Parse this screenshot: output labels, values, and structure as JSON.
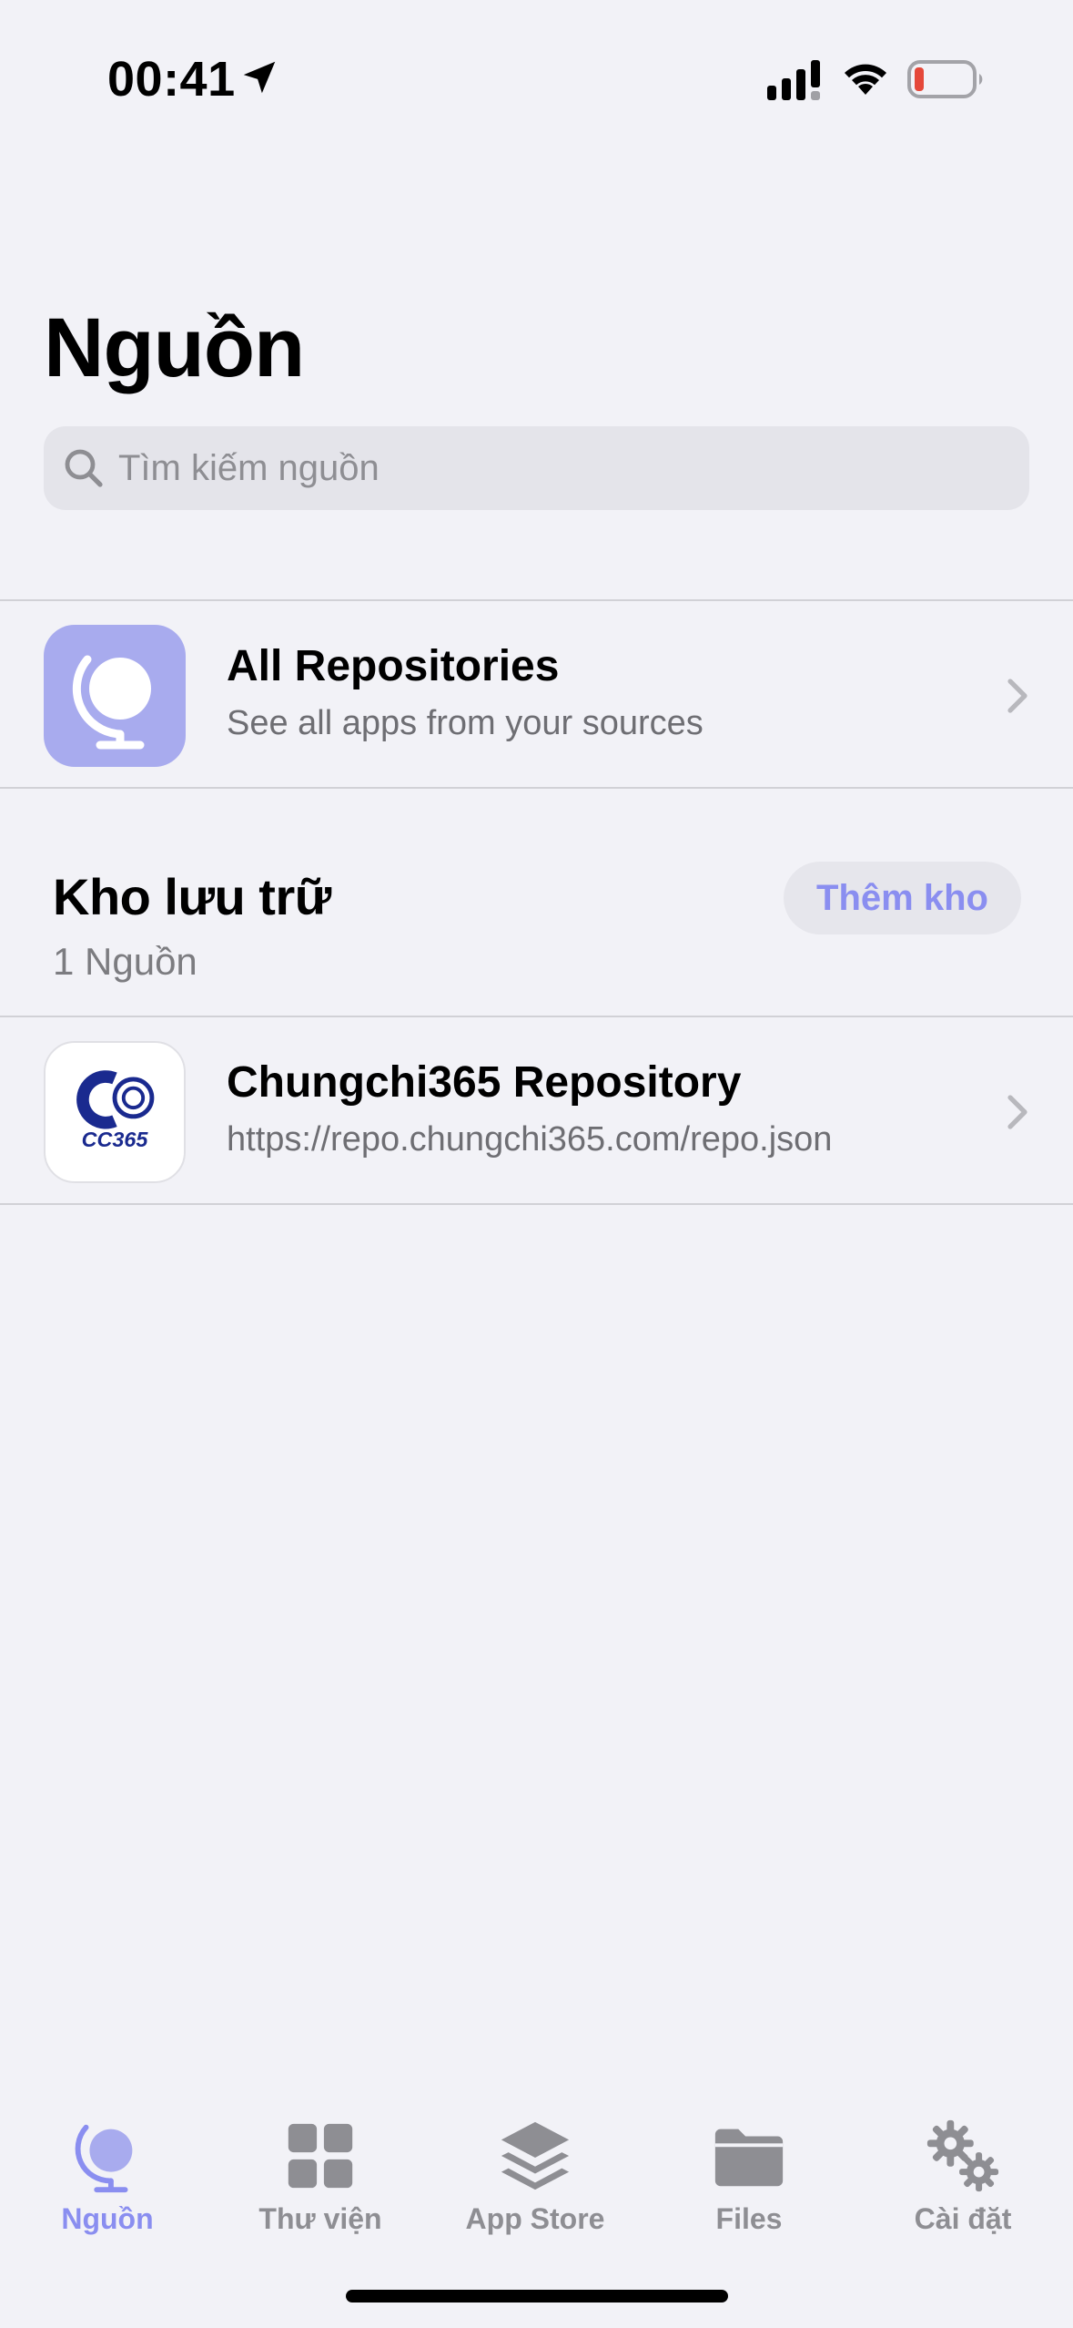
{
  "status_bar": {
    "time": "00:41",
    "icons": [
      "location-arrow-icon",
      "cellular-signal-icon",
      "wifi-icon",
      "battery-low-icon"
    ],
    "battery_color": "#e5483a"
  },
  "header": {
    "title": "Nguồn"
  },
  "search": {
    "placeholder": "Tìm kiếm nguồn",
    "value": ""
  },
  "all_repositories": {
    "title": "All Repositories",
    "subtitle": "See all apps from your sources",
    "icon": "globe-icon",
    "icon_bg": "#a8abee"
  },
  "section": {
    "title": "Kho lưu trữ",
    "count": "1 Nguồn",
    "add_label": "Thêm kho"
  },
  "repositories": [
    {
      "name": "Chungchi365 Repository",
      "url": "https://repo.chungchi365.com/repo.json",
      "logo_text": "CC365",
      "icon": "cc365-logo-icon"
    }
  ],
  "tab_bar": {
    "tabs": [
      {
        "label": "Nguồn",
        "icon": "globe-icon",
        "active": true
      },
      {
        "label": "Thư viện",
        "icon": "grid-icon",
        "active": false
      },
      {
        "label": "App Store",
        "icon": "layers-icon",
        "active": false
      },
      {
        "label": "Files",
        "icon": "folder-icon",
        "active": false
      },
      {
        "label": "Cài đặt",
        "icon": "gears-icon",
        "active": false
      }
    ]
  },
  "colors": {
    "accent": "#8a8ef0",
    "background": "#f2f2f7",
    "secondary_text": "#6e6e73",
    "inactive_tab": "#8e8e93"
  }
}
